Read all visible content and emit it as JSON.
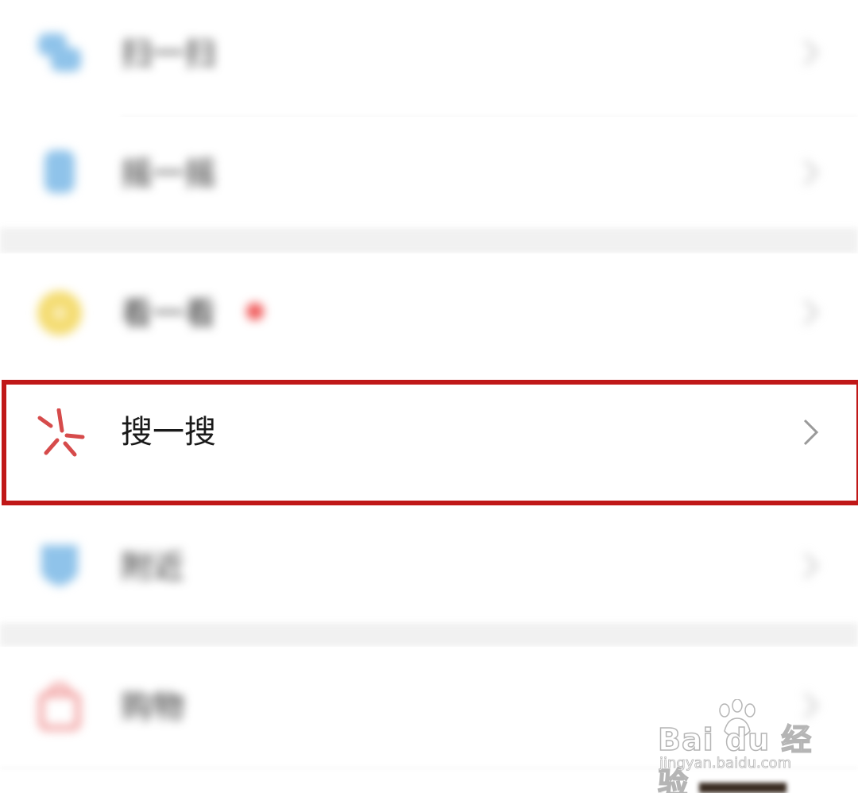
{
  "menu": {
    "items": [
      {
        "label": "扫一扫",
        "icon": "scan-icon",
        "blurred": true
      },
      {
        "label": "摇一摇",
        "icon": "shake-icon",
        "blurred": true
      },
      {
        "label": "看一看",
        "icon": "look-icon",
        "blurred": true,
        "badge": "red-dot"
      },
      {
        "label": "搜一搜",
        "icon": "search-sparkle-icon",
        "blurred": false,
        "highlighted": true
      },
      {
        "label": "附近",
        "icon": "nearby-icon",
        "blurred": true
      },
      {
        "label": "购物",
        "icon": "shopping-icon",
        "blurred": true
      }
    ]
  },
  "highlight_color": "#c01818",
  "watermark": {
    "brand": "Bai du 经验",
    "url": "jingyan.baidu.com"
  },
  "colors": {
    "scan_icon": "#8fc3ea",
    "shake_icon": "#8fc3ea",
    "look_icon": "#f4dc72",
    "search_icon": "#d64b4b",
    "nearby_icon": "#8fc3ea",
    "shopping_icon": "#ef8f8f",
    "badge": "#f05a5a"
  }
}
